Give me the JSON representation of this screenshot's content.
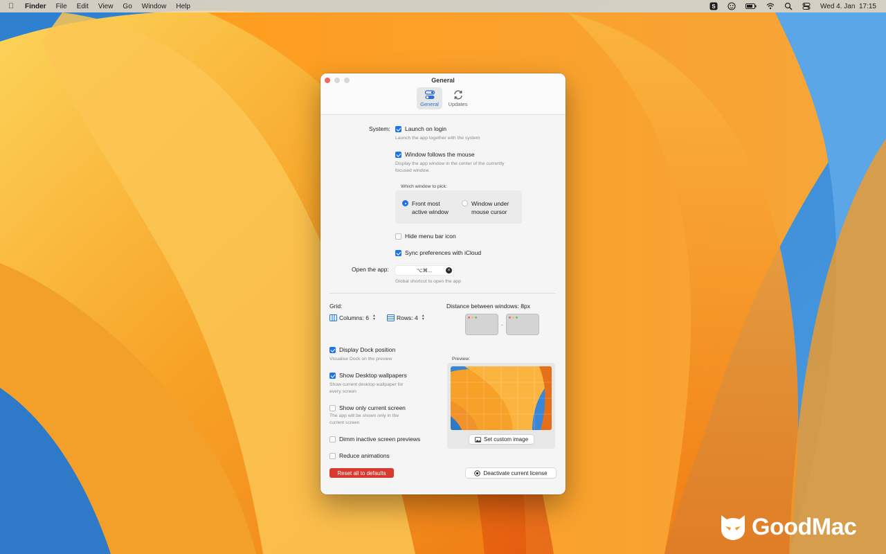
{
  "menubar": {
    "app_name": "Finder",
    "menus": [
      "File",
      "Edit",
      "View",
      "Go",
      "Window",
      "Help"
    ],
    "clock": "Wed 4. Jan  17:15",
    "icons": [
      "apple-icon",
      "s-app-icon",
      "cloud-app-icon",
      "battery-icon",
      "wifi-icon",
      "search-icon",
      "control-center-icon"
    ]
  },
  "window": {
    "title": "General",
    "tabs": [
      {
        "label": "General",
        "icon": "toggles-icon",
        "active": true
      },
      {
        "label": "Updates",
        "icon": "refresh-icon",
        "active": false
      }
    ]
  },
  "system": {
    "section_label": "System:",
    "launch_on_login": {
      "label": "Launch on login",
      "checked": true,
      "desc": "Launch the app together with the system"
    },
    "window_follows": {
      "label": "Window follows the mouse",
      "checked": true,
      "desc_line1": "Display the app window in the center of the currently",
      "desc_line2": "focused window."
    },
    "which_window": {
      "label": "Which window to pick:",
      "option1_line1": "Front most",
      "option1_line2": "active window",
      "option2_line1": "Window under",
      "option2_line2": "mouse cursor",
      "selected": "Front most active window"
    },
    "hide_menu_bar_icon": {
      "label": "Hide menu bar icon",
      "checked": false
    },
    "sync_icloud": {
      "label": "Sync preferences with iCloud",
      "checked": true
    },
    "open_app": {
      "label": "Open the app:",
      "shortcut": "⌥⌘...",
      "desc": "Global shortcut to open the app"
    }
  },
  "grid": {
    "label": "Grid:",
    "columns_label": "Columns: 6",
    "rows_label": "Rows: 4",
    "distance_label": "Distance between windows: 8px"
  },
  "options": {
    "display_dock": {
      "label": "Display Dock position",
      "checked": true,
      "desc": "Visualise Dock on the preview"
    },
    "show_wallpapers": {
      "label": "Show Desktop wallpapers",
      "checked": true,
      "desc_line1": "Show current desktop wallpaper for",
      "desc_line2": "every screen"
    },
    "show_only_current": {
      "label": "Show only current screen",
      "checked": false,
      "desc_line1": "The app will be shown only in the",
      "desc_line2": "current screen"
    },
    "dimm_inactive": {
      "label": "Dimm inactive screen previews",
      "checked": false
    },
    "reduce_animations": {
      "label": "Reduce animations",
      "checked": false
    }
  },
  "preview": {
    "label": "Preview:",
    "set_custom_image": "Set custom image"
  },
  "buttons": {
    "reset": "Reset all to defaults",
    "deactivate": "Deactivate current license"
  },
  "watermark": {
    "text": "GoodMac"
  },
  "colors": {
    "accent": "#1f74e8",
    "danger": "#d83a30",
    "wallpaper_orange": "#f39a1d"
  }
}
